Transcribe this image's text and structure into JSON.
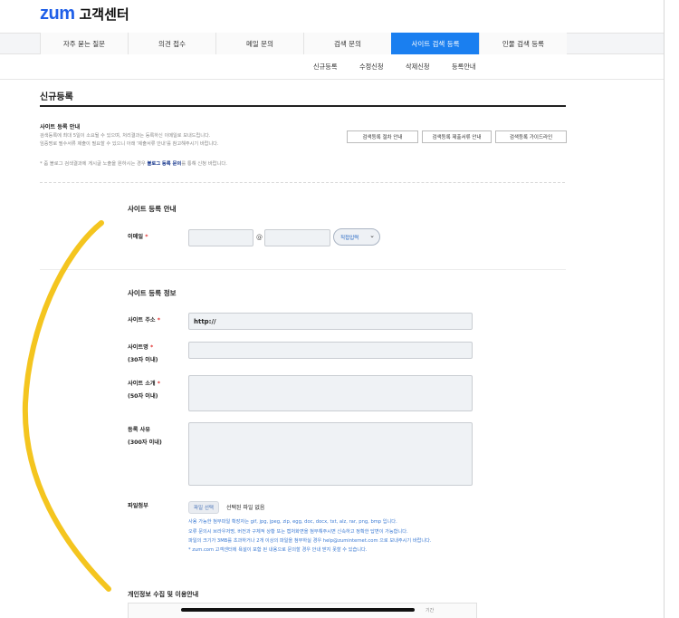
{
  "logo": {
    "brand": "zum",
    "suffix": "고객센터"
  },
  "gnb": {
    "tabs": [
      {
        "label": "자주 묻는 질문",
        "active": false
      },
      {
        "label": "의견 접수",
        "active": false
      },
      {
        "label": "메일 문의",
        "active": false
      },
      {
        "label": "검색 문의",
        "active": false
      },
      {
        "label": "사이트 검색 등록",
        "active": true
      },
      {
        "label": "인물 검색 등록",
        "active": false
      }
    ]
  },
  "lnb": {
    "items": [
      "신규등록",
      "수정신청",
      "삭제신청",
      "등록안내"
    ]
  },
  "page_title": "신규등록",
  "info": {
    "heading": "사이트 등록 안내",
    "line1": "검색등록에 최대 5일이 소요될 수 있으며, 처리결과는 등록하신 이메일로 보내드립니다.",
    "line2": "임증명로 필수서류 제출이 필요할 수 있으니 아래 '제출서류 안내'를 참고해주시기 바랍니다.",
    "buttons": [
      "검색등록 절차 안내",
      "검색등록 제출서류 안내",
      "검색등록 가이드라인"
    ],
    "note_prefix": "* 줌 블로그 검색결과에 게시글 노출을 원하시는 경우",
    "note_link": "블로그 등록 문의",
    "note_suffix": "를 통해 신청 바랍니다."
  },
  "email_section": {
    "title": "사이트 등록 안내",
    "label": "이메일",
    "required_mark": "*",
    "at": "@",
    "domain_select": "직접입력"
  },
  "site_section": {
    "title": "사이트 등록 정보",
    "url_label": "사이트 주소",
    "url_value": "http://",
    "name_label": "사이트명",
    "name_limit": "(30자 이내)",
    "desc_label": "사이트 소개",
    "desc_limit": "(50자 이내)",
    "reason_label": "등록 사유",
    "reason_limit": "(300자 이내)",
    "file_label": "파일첨부",
    "file_button": "파일 선택",
    "file_status": "선택된 파일 없음",
    "help": [
      "사용 가능한 첨부파일 확장자는 gif, jpg, jpeg, zip, egg, doc, docx, txt, alz, rar, png, bmp 입니다.",
      "오류 문의시 브라우저명, 버전과 구체적 상황 또는 캡처화면을 첨부해주시면 신속하고 정확한 답변이 가능합니다.",
      "파일의 크기가 3MB를 초과하거나 2개 이상의 파일을 첨부하실 경우 help@zuminternet.com 으로 보내주시기 바랍니다.",
      "* zum.com 고객센터에 욕설이 포함 된 내용으로 문의할 경우 안내 받지 못할 수 있습니다."
    ]
  },
  "privacy": {
    "heading": "개인정보 수집 및 이용안내",
    "col_right": "기간"
  },
  "colors": {
    "brand": "#1f5fe8",
    "active_tab": "#1a7ff0",
    "required": "#e0302e",
    "annotation": "#f4c51f"
  }
}
